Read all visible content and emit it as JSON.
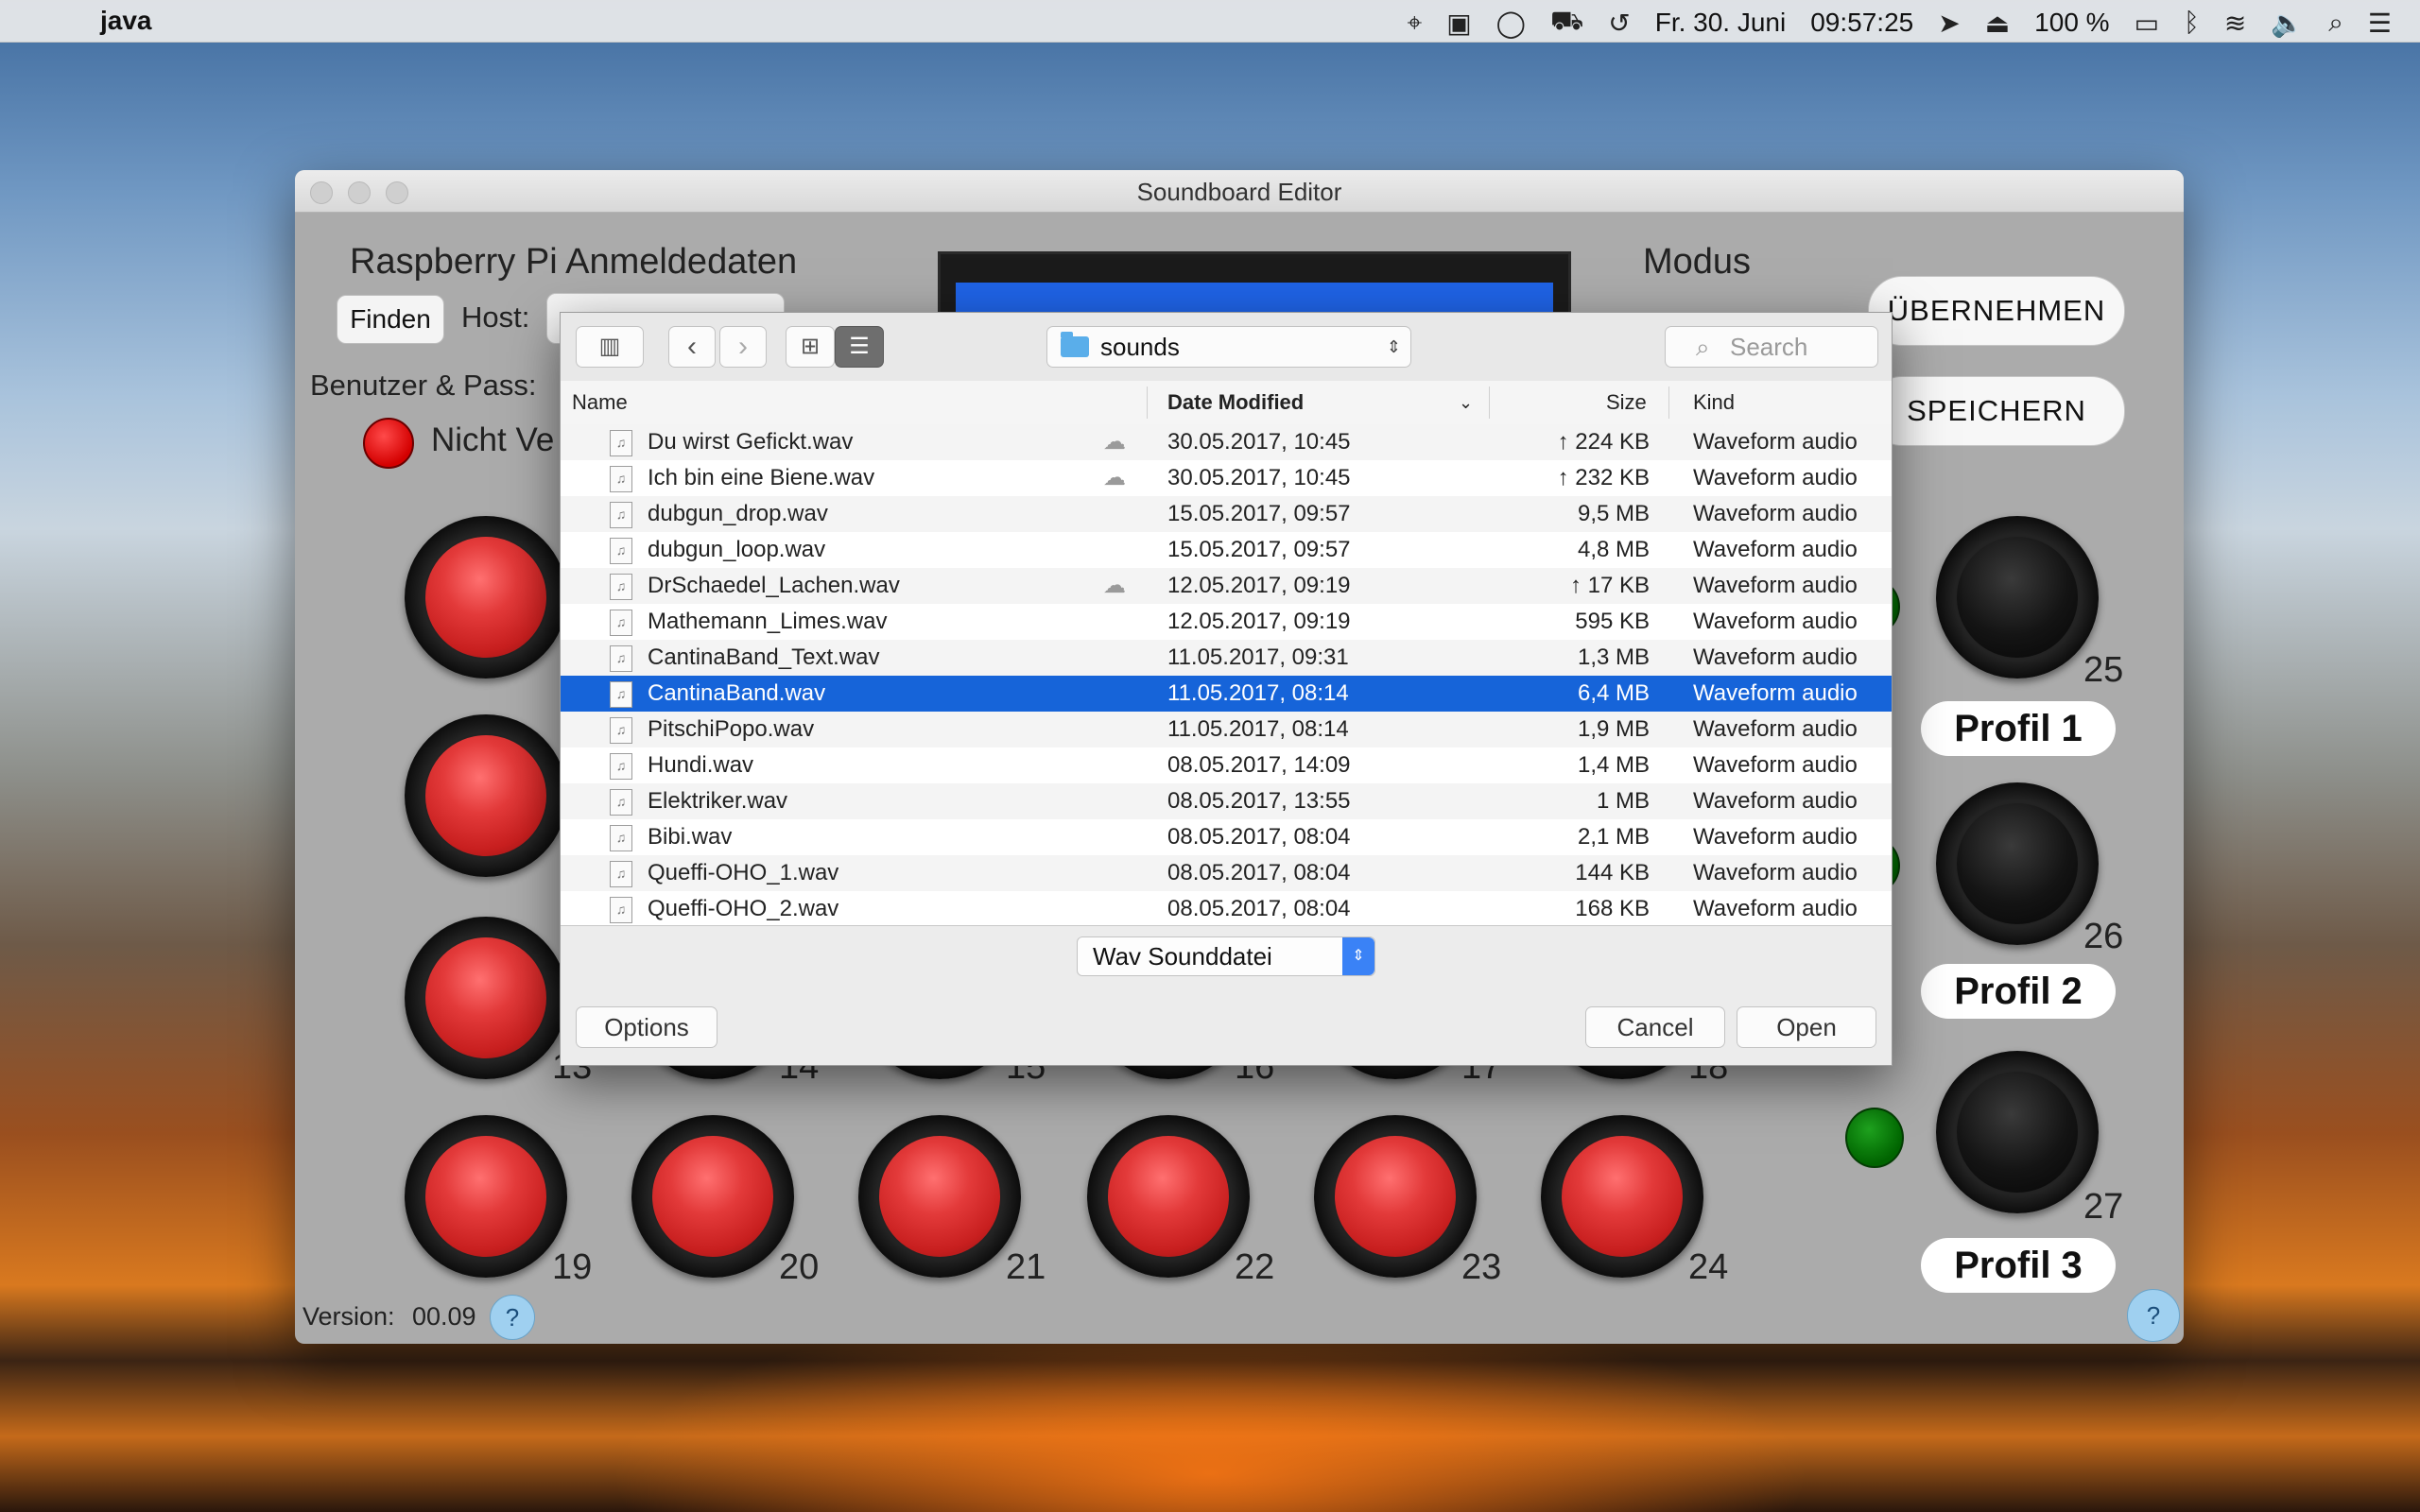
{
  "menubar": {
    "app_name": "java",
    "date": "Fr. 30. Juni",
    "time": "09:57:25",
    "battery": "100 %"
  },
  "window": {
    "title": "Soundboard Editor",
    "heading": "Raspberry Pi Anmeldedaten",
    "find_button": "Finden",
    "host_label": "Host:",
    "user_label": "Benutzer & Pass:",
    "status_text": "Nicht Ve",
    "modus_label": "Modus",
    "apply_button": "ÜBERNEHMEN",
    "save_button": "SPEICHERN",
    "version_label": "Version:",
    "version_value": "00.09",
    "help_symbol": "?",
    "pad_numbers": [
      "13",
      "14",
      "15",
      "16",
      "17",
      "18",
      "19",
      "20",
      "21",
      "22",
      "23",
      "24",
      "25",
      "26",
      "27"
    ],
    "profiles": [
      "Profil 1",
      "Profil 2",
      "Profil 3"
    ],
    "colors": {
      "pad_red": "#d62b2b",
      "led_red": "#e00000",
      "led_green": "#0a7a0a",
      "window_bg": "#ababab"
    }
  },
  "dialog": {
    "folder": "sounds",
    "search_placeholder": "Search",
    "columns": {
      "name": "Name",
      "date": "Date Modified",
      "size": "Size",
      "kind": "Kind"
    },
    "files": [
      {
        "name": "Du wirst Gefickt.wav",
        "date": "30.05.2017, 10:45",
        "size": "↑ 224 KB",
        "kind": "Waveform audio",
        "cloud": true
      },
      {
        "name": "Ich bin eine Biene.wav",
        "date": "30.05.2017, 10:45",
        "size": "↑ 232 KB",
        "kind": "Waveform audio",
        "cloud": true
      },
      {
        "name": "dubgun_drop.wav",
        "date": "15.05.2017, 09:57",
        "size": "9,5 MB",
        "kind": "Waveform audio",
        "cloud": false
      },
      {
        "name": "dubgun_loop.wav",
        "date": "15.05.2017, 09:57",
        "size": "4,8 MB",
        "kind": "Waveform audio",
        "cloud": false
      },
      {
        "name": "DrSchaedel_Lachen.wav",
        "date": "12.05.2017, 09:19",
        "size": "↑ 17 KB",
        "kind": "Waveform audio",
        "cloud": true
      },
      {
        "name": "Mathemann_Limes.wav",
        "date": "12.05.2017, 09:19",
        "size": "595 KB",
        "kind": "Waveform audio",
        "cloud": false
      },
      {
        "name": "CantinaBand_Text.wav",
        "date": "11.05.2017, 09:31",
        "size": "1,3 MB",
        "kind": "Waveform audio",
        "cloud": false
      },
      {
        "name": "CantinaBand.wav",
        "date": "11.05.2017, 08:14",
        "size": "6,4 MB",
        "kind": "Waveform audio",
        "cloud": false,
        "selected": true
      },
      {
        "name": "PitschiPopo.wav",
        "date": "11.05.2017, 08:14",
        "size": "1,9 MB",
        "kind": "Waveform audio",
        "cloud": false
      },
      {
        "name": "Hundi.wav",
        "date": "08.05.2017, 14:09",
        "size": "1,4 MB",
        "kind": "Waveform audio",
        "cloud": false
      },
      {
        "name": "Elektriker.wav",
        "date": "08.05.2017, 13:55",
        "size": "1 MB",
        "kind": "Waveform audio",
        "cloud": false
      },
      {
        "name": "Bibi.wav",
        "date": "08.05.2017, 08:04",
        "size": "2,1 MB",
        "kind": "Waveform audio",
        "cloud": false
      },
      {
        "name": "Queffi-OHO_1.wav",
        "date": "08.05.2017, 08:04",
        "size": "144 KB",
        "kind": "Waveform audio",
        "cloud": false
      },
      {
        "name": "Queffi-OHO_2.wav",
        "date": "08.05.2017, 08:04",
        "size": "168 KB",
        "kind": "Waveform audio",
        "cloud": false
      }
    ],
    "file_type": "Wav Sounddatei",
    "options_button": "Options",
    "cancel_button": "Cancel",
    "open_button": "Open",
    "selection_color": "#1664d9"
  }
}
